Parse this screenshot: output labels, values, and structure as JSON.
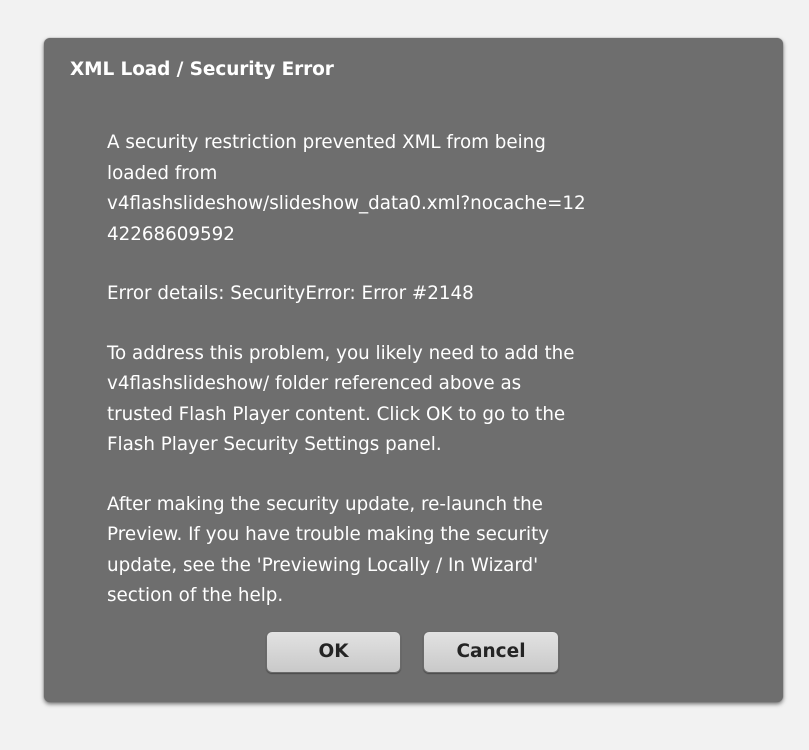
{
  "dialog": {
    "title": "XML Load / Security Error",
    "paragraphs": [
      "A security restriction prevented XML from being\nloaded from\nv4flashslideshow/slideshow_data0.xml?nocache=12\n42268609592",
      "Error details: SecurityError: Error #2148",
      "To address this problem, you likely need to add the\nv4flashslideshow/ folder referenced above as\ntrusted Flash Player content.  Click OK to go to the\nFlash Player Security Settings panel.",
      "After making the security update, re-launch the\nPreview.  If you have trouble making the security\nupdate, see the 'Previewing Locally / In Wizard'\nsection of the help."
    ],
    "buttons": {
      "ok_label": "OK",
      "cancel_label": "Cancel"
    }
  },
  "colors": {
    "page_background": "#f2f2f2",
    "dialog_background": "#6e6e6e",
    "text": "#ffffff",
    "button_background": "#d4d4d4",
    "button_text": "#242424"
  }
}
